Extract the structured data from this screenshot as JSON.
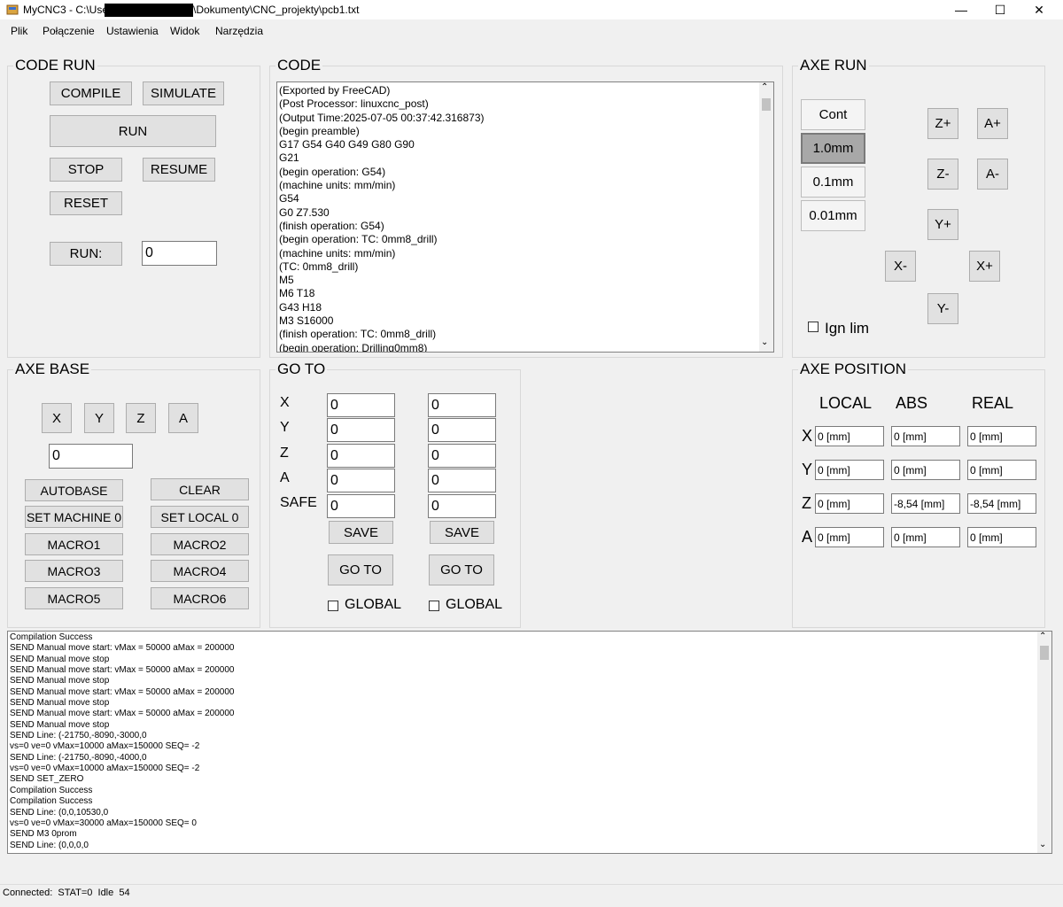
{
  "window": {
    "title_prefix": "MyCNC3 - C:\\Users\\",
    "title_suffix": "\\Dokumenty\\CNC_projekty\\pcb1.txt",
    "minimize": "—",
    "maximize": "☐",
    "close": "✕",
    "icon": "app-icon"
  },
  "menu": [
    "Plik",
    "Połączenie",
    "Ustawienia",
    "Widok",
    "Narzędzia"
  ],
  "code_run": {
    "title": "CODE RUN",
    "compile": "COMPILE",
    "simulate": "SIMULATE",
    "run": "RUN",
    "stop": "STOP",
    "resume": "RESUME",
    "reset": "RESET",
    "run_line_label": "RUN:",
    "run_line_value": "0"
  },
  "code": {
    "title": "CODE",
    "lines": [
      "(Exported by FreeCAD)",
      "(Post Processor: linuxcnc_post)",
      "(Output Time:2025-07-05 00:37:42.316873)",
      "(begin preamble)",
      "G17 G54 G40 G49 G80 G90",
      "G21",
      "(begin operation: G54)",
      "(machine units: mm/min)",
      "G54",
      "G0 Z7.530",
      "(finish operation: G54)",
      "(begin operation: TC: 0mm8_drill)",
      "(machine units: mm/min)",
      "(TC: 0mm8_drill)",
      "M5",
      "M6 T18",
      "G43 H18",
      "M3 S16000",
      "(finish operation: TC: 0mm8_drill)",
      "(begin operation: Drilling0mm8)"
    ]
  },
  "axe_run": {
    "title": "AXE RUN",
    "steps": [
      "Cont",
      "1.0mm",
      "0.1mm",
      "0.01mm"
    ],
    "selected_step": "1.0mm",
    "z_plus": "Z+",
    "a_plus": "A+",
    "z_minus": "Z-",
    "a_minus": "A-",
    "y_plus": "Y+",
    "x_minus": "X-",
    "x_plus": "X+",
    "y_minus": "Y-",
    "ign_lim": "Ign lim",
    "ign_lim_checked": false
  },
  "axe_base": {
    "title": "AXE BASE",
    "axes": [
      "X",
      "Y",
      "Z",
      "A"
    ],
    "value": "0",
    "autobase": "AUTOBASE",
    "clear": "CLEAR",
    "set_machine": "SET MACHINE 0",
    "set_local": "SET LOCAL 0",
    "macros": [
      "MACRO1",
      "MACRO2",
      "MACRO3",
      "MACRO4",
      "MACRO5",
      "MACRO6"
    ]
  },
  "goto": {
    "title": "GO TO",
    "rows": [
      {
        "label": "X",
        "v1": "0",
        "v2": "0"
      },
      {
        "label": "Y",
        "v1": "0",
        "v2": "0"
      },
      {
        "label": "Z",
        "v1": "0",
        "v2": "0"
      },
      {
        "label": "A",
        "v1": "0",
        "v2": "0"
      },
      {
        "label": "SAFE",
        "v1": "0",
        "v2": "0"
      }
    ],
    "save": "SAVE",
    "goto_button": "GO TO",
    "global": "GLOBAL",
    "global1_checked": false,
    "global2_checked": false
  },
  "axe_position": {
    "title": "AXE POSITION",
    "headers": [
      "LOCAL",
      "ABS",
      "REAL"
    ],
    "rows": [
      {
        "axis": "X",
        "local": "0 [mm]",
        "abs": "0 [mm]",
        "real": "0 [mm]"
      },
      {
        "axis": "Y",
        "local": "0 [mm]",
        "abs": "0 [mm]",
        "real": "0 [mm]"
      },
      {
        "axis": "Z",
        "local": "0 [mm]",
        "abs": "-8,54 [mm]",
        "real": "-8,54 [mm]"
      },
      {
        "axis": "A",
        "local": "0 [mm]",
        "abs": "0 [mm]",
        "real": "0 [mm]"
      }
    ]
  },
  "log": {
    "lines": [
      "Compilation Success",
      "SEND Manual move start: vMax = 50000 aMax = 200000",
      "SEND Manual move stop",
      "SEND Manual move start: vMax = 50000 aMax = 200000",
      "SEND Manual move stop",
      "SEND Manual move start: vMax = 50000 aMax = 200000",
      "SEND Manual move stop",
      "SEND Manual move start: vMax = 50000 aMax = 200000",
      "SEND Manual move stop",
      "SEND Line: (-21750,-8090,-3000,0",
      "vs=0 ve=0 vMax=10000 aMax=150000 SEQ= -2",
      "SEND Line: (-21750,-8090,-4000,0",
      "vs=0 ve=0 vMax=10000 aMax=150000 SEQ= -2",
      "SEND SET_ZERO",
      "Compilation Success",
      "Compilation Success",
      "SEND Line: (0,0,10530,0",
      "vs=0 ve=0 vMax=30000 aMax=150000 SEQ= 0",
      "SEND M3 0prom",
      "SEND Line: (0,0,0,0"
    ]
  },
  "status": {
    "text": "Connected:  STAT=0  Idle  54"
  }
}
